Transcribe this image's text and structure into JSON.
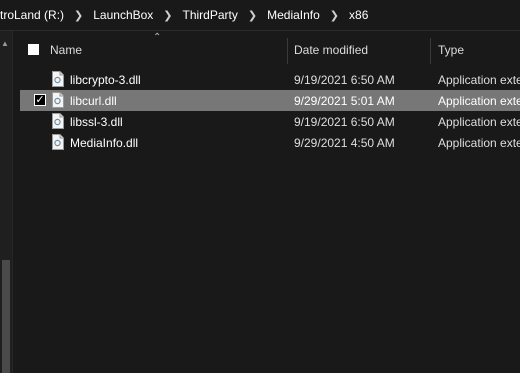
{
  "breadcrumbs": [
    "troLand (R:)",
    "LaunchBox",
    "ThirdParty",
    "MediaInfo",
    "x86"
  ],
  "columns": {
    "name": "Name",
    "date_modified": "Date modified",
    "type": "Type"
  },
  "files": [
    {
      "name": "libcrypto-3.dll",
      "date": "9/19/2021 6:50 AM",
      "type": "Application exte",
      "selected": false
    },
    {
      "name": "libcurl.dll",
      "date": "9/29/2021 5:01 AM",
      "type": "Application exte",
      "selected": true
    },
    {
      "name": "libssl-3.dll",
      "date": "9/19/2021 6:50 AM",
      "type": "Application exte",
      "selected": false
    },
    {
      "name": "MediaInfo.dll",
      "date": "9/29/2021 4:50 AM",
      "type": "Application exte",
      "selected": false
    }
  ],
  "icons": {
    "file": "dll-file-icon",
    "breadcrumb_separator": "chevron-right-icon",
    "sort": "sort-ascending-icon"
  },
  "colors": {
    "background": "#191919",
    "selected_row": "#777777",
    "text": "#ffffff"
  }
}
